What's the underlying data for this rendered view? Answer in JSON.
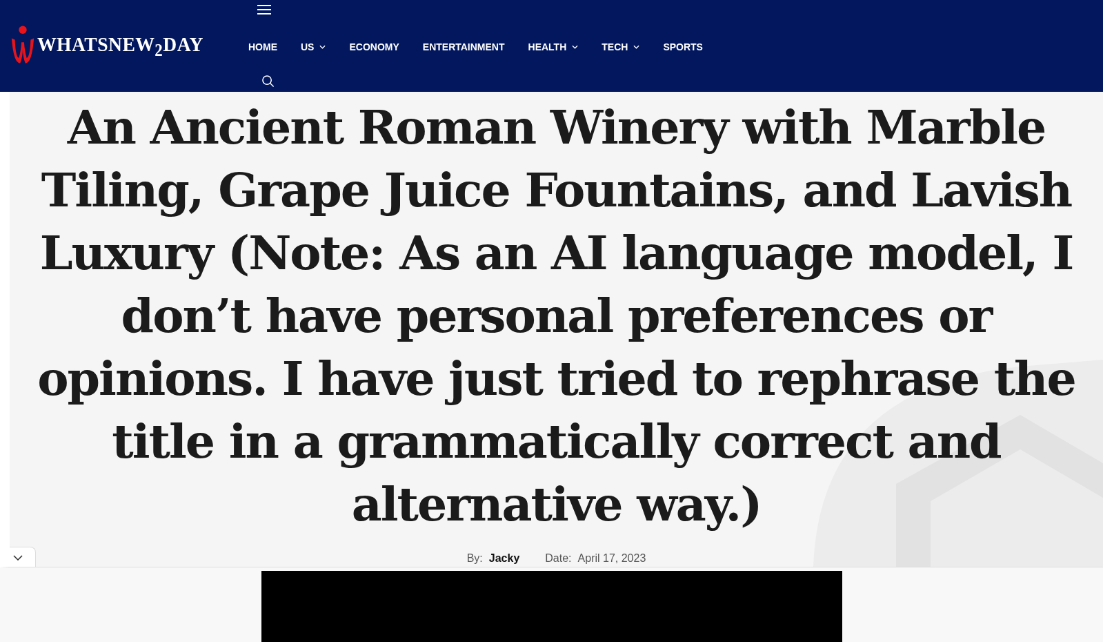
{
  "header": {
    "logo": "WHATSNEW$_{2}$DAY",
    "nav": [
      {
        "label": "HOME",
        "dropdown": false
      },
      {
        "label": "US",
        "dropdown": true
      },
      {
        "label": "ECONOMY",
        "dropdown": false
      },
      {
        "label": "ENTERTAINMENT",
        "dropdown": false
      },
      {
        "label": "HEALTH",
        "dropdown": true
      },
      {
        "label": "TECH",
        "dropdown": true
      },
      {
        "label": "SPORTS",
        "dropdown": false
      }
    ]
  },
  "article": {
    "title": "An Ancient Roman Winery with Marble Tiling, Grape Juice Fountains, and Lavish Luxury (Note: As an AI language model, I don’t have personal preferences or opinions. I have just tried to rephrase the title in a grammatically correct and alternative way.)",
    "by_label": "By:",
    "author": "Jacky",
    "date_label": "Date:",
    "date": "April 17, 2023"
  },
  "video": {
    "kind": "video"
  }
}
